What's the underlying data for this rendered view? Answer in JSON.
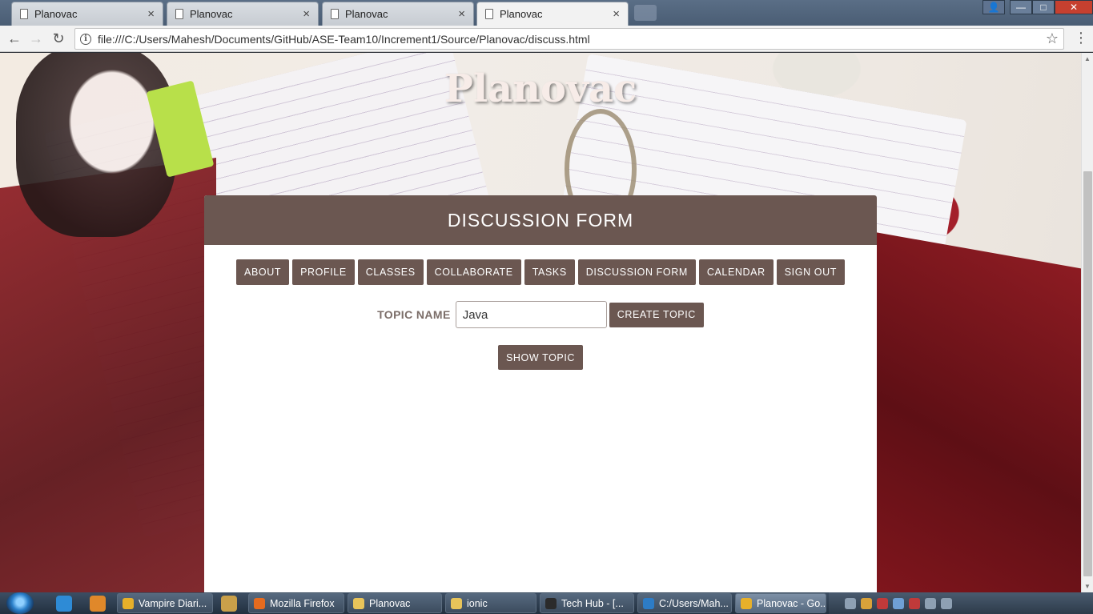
{
  "browser": {
    "tabs": [
      {
        "title": "Planovac",
        "close": "×",
        "active": false
      },
      {
        "title": "Planovac",
        "close": "×",
        "active": false
      },
      {
        "title": "Planovac",
        "close": "×",
        "active": false
      },
      {
        "title": "Planovac",
        "close": "×",
        "active": true
      }
    ],
    "window_controls": {
      "minimize": "—",
      "maximize": "□",
      "close": "✕",
      "user": "👤"
    },
    "nav": {
      "back": "←",
      "forward": "→",
      "reload": "↻"
    },
    "address": "file:///C:/Users/Mahesh/Documents/GitHub/ASE-Team10/Increment1/Source/Planovac/discuss.html",
    "info_glyph": "i",
    "star": "☆",
    "menu": "⋮"
  },
  "page": {
    "site_title": "Planovac",
    "form_title": "DISCUSSION FORM",
    "nav_items": [
      "ABOUT",
      "PROFILE",
      "CLASSES",
      "COLLABORATE",
      "TASKS",
      "DISCUSSION FORM",
      "CALENDAR",
      "SIGN OUT"
    ],
    "topic_label": "TOPIC NAME",
    "topic_value": "Java",
    "create_button": "CREATE TOPIC",
    "show_button": "SHOW TOPIC"
  },
  "scrollbar": {
    "up": "▲",
    "down": "▼"
  },
  "taskbar": {
    "tasks": [
      {
        "label": "Vampire Diari...",
        "icon_color": "#e7b02a",
        "active": false
      },
      {
        "label": "Mozilla Firefox",
        "icon_color": "#e66b1f",
        "active": false
      },
      {
        "label": "Planovac",
        "icon_color": "#e8c45a",
        "active": false
      },
      {
        "label": "ionic",
        "icon_color": "#e8c45a",
        "active": false
      },
      {
        "label": "Tech Hub - [...",
        "icon_color": "#2b2b2b",
        "active": false
      },
      {
        "label": "C:/Users/Mah...",
        "icon_color": "#2d7cc6",
        "active": false
      },
      {
        "label": "Planovac - Go...",
        "icon_color": "#e7b02a",
        "active": true
      }
    ]
  },
  "colors": {
    "accent": "#6b5751",
    "card_bg": "#ffffff",
    "label_text": "#7b6d68"
  }
}
